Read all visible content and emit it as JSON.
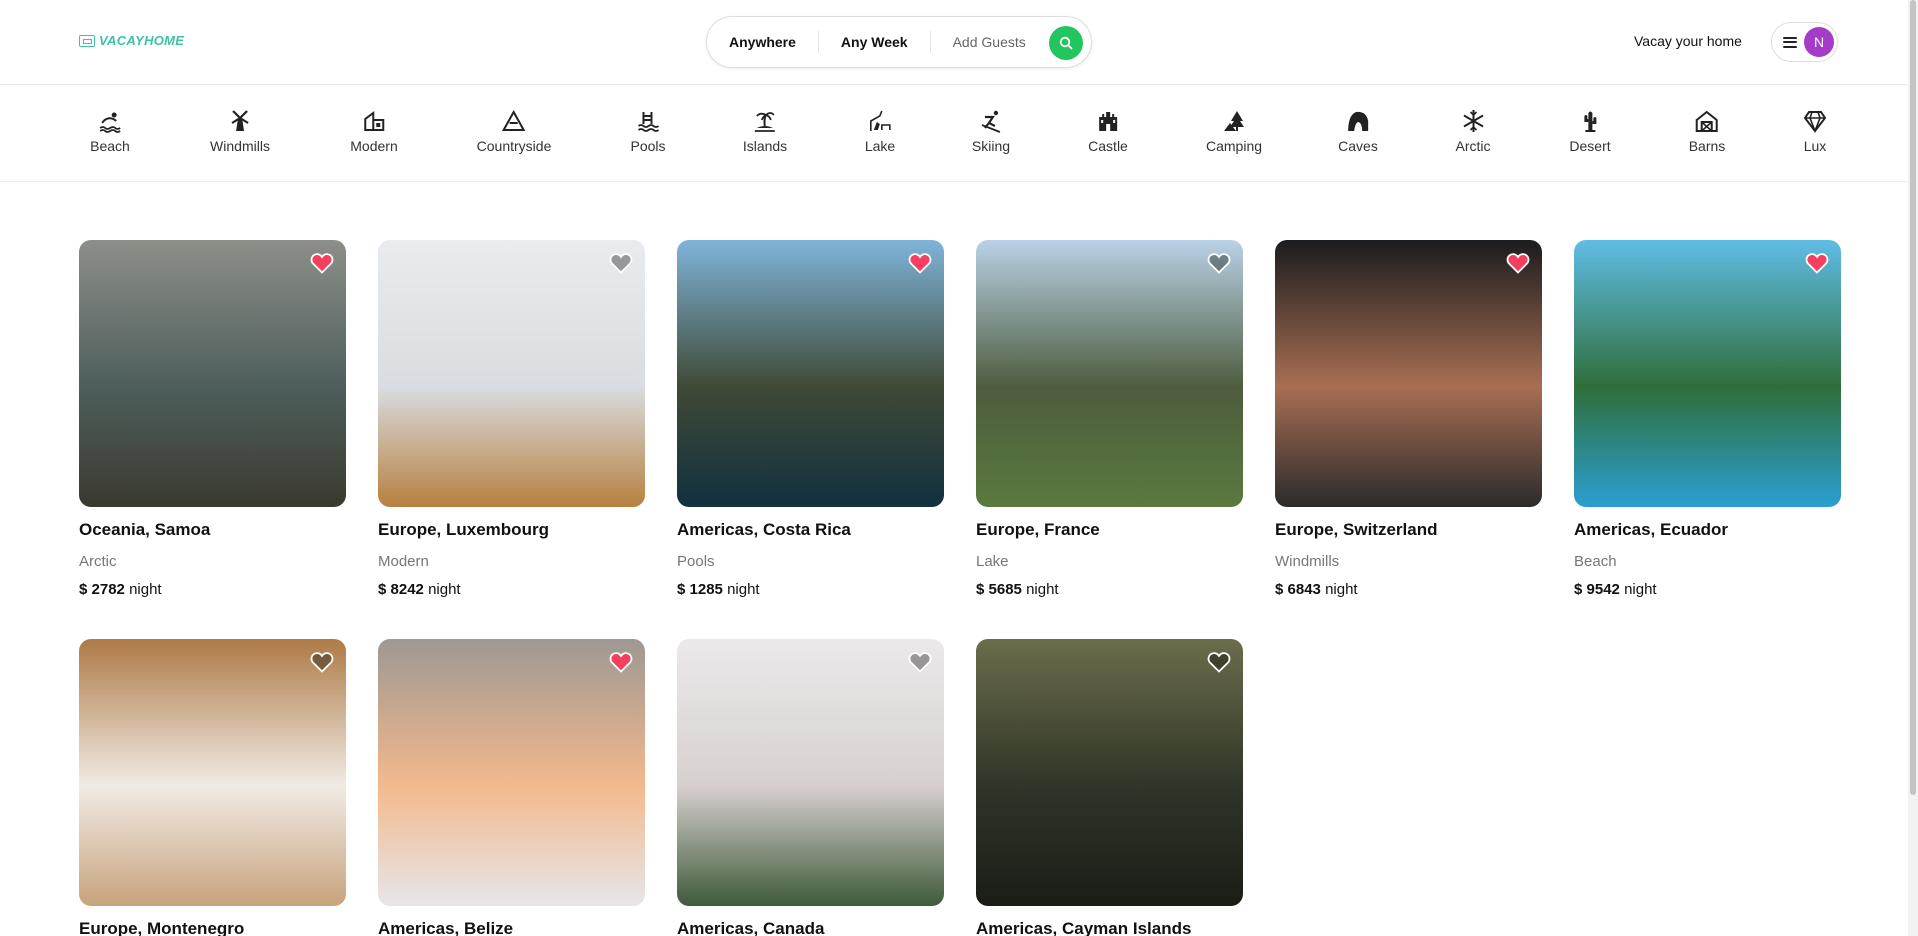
{
  "header": {
    "logo_text": "VACAYHOME",
    "search": {
      "where": "Anywhere",
      "when": "Any Week",
      "guests": "Add Guests"
    },
    "host_link": "Vacay your home",
    "avatar_initial": "N"
  },
  "categories": [
    {
      "label": "Beach",
      "icon": "beach-icon"
    },
    {
      "label": "Windmills",
      "icon": "windmill-icon"
    },
    {
      "label": "Modern",
      "icon": "modern-house-icon"
    },
    {
      "label": "Countryside",
      "icon": "mountain-icon"
    },
    {
      "label": "Pools",
      "icon": "pool-icon"
    },
    {
      "label": "Islands",
      "icon": "island-icon"
    },
    {
      "label": "Lake",
      "icon": "lake-icon"
    },
    {
      "label": "Skiing",
      "icon": "skiing-icon"
    },
    {
      "label": "Castle",
      "icon": "castle-icon"
    },
    {
      "label": "Camping",
      "icon": "camping-icon"
    },
    {
      "label": "Caves",
      "icon": "cave-icon"
    },
    {
      "label": "Arctic",
      "icon": "snowflake-icon"
    },
    {
      "label": "Desert",
      "icon": "cactus-icon"
    },
    {
      "label": "Barns",
      "icon": "barn-icon"
    },
    {
      "label": "Lux",
      "icon": "diamond-icon"
    }
  ],
  "listings": [
    {
      "title": "Oceania, Samoa",
      "category": "Arctic",
      "price": "$ 2782",
      "unit": "night",
      "favorited": true,
      "colors": [
        "#8c8f88",
        "#4e5e5c",
        "#3a3a2e"
      ]
    },
    {
      "title": "Europe, Luxembourg",
      "category": "Modern",
      "price": "$ 8242",
      "unit": "night",
      "favorited": false,
      "colors": [
        "#e8ecef",
        "#d9dce0",
        "#b7803f"
      ]
    },
    {
      "title": "Americas, Costa Rica",
      "category": "Pools",
      "price": "$ 1285",
      "unit": "night",
      "favorited": true,
      "colors": [
        "#7fb4da",
        "#3f4a36",
        "#123040"
      ]
    },
    {
      "title": "Europe, France",
      "category": "Lake",
      "price": "$ 5685",
      "unit": "night",
      "favorited": false,
      "colors": [
        "#b9d2e6",
        "#4e5c3e",
        "#5a7a3e"
      ]
    },
    {
      "title": "Europe, Switzerland",
      "category": "Windmills",
      "price": "$ 6843",
      "unit": "night",
      "favorited": true,
      "colors": [
        "#1b1c1e",
        "#a86e52",
        "#2b2b2c"
      ]
    },
    {
      "title": "Americas, Ecuador",
      "category": "Beach",
      "price": "$ 9542",
      "unit": "night",
      "favorited": true,
      "colors": [
        "#5fbde6",
        "#2f6e3a",
        "#2b9fd0"
      ]
    },
    {
      "title": "Europe, Montenegro",
      "category": "",
      "price": "",
      "unit": "",
      "favorited": false,
      "colors": [
        "#ae7a46",
        "#f1ebe5",
        "#c8a37d"
      ]
    },
    {
      "title": "Americas, Belize",
      "category": "",
      "price": "",
      "unit": "",
      "favorited": true,
      "colors": [
        "#9e9893",
        "#f3b98d",
        "#e6e6ea"
      ]
    },
    {
      "title": "Americas, Canada",
      "category": "",
      "price": "",
      "unit": "",
      "favorited": false,
      "colors": [
        "#ece9ea",
        "#d7d0cf",
        "#3f5a3a"
      ]
    },
    {
      "title": "Americas, Cayman Islands",
      "category": "",
      "price": "",
      "unit": "",
      "favorited": false,
      "colors": [
        "#6b6d4a",
        "#2f3528",
        "#1a1d16"
      ]
    }
  ],
  "colors": {
    "accent": "#22c55e",
    "heart_active": "#f43f5e",
    "logo": "#3cc3a4",
    "avatar": "#a43cc8"
  }
}
